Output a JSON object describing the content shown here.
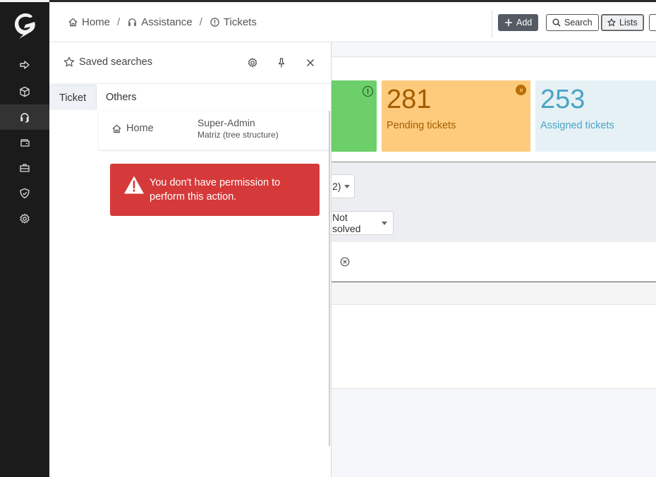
{
  "sidebar": {
    "logo": "glpi-logo",
    "items": [
      {
        "icon": "arrow-right-icon",
        "name": "sidebar-item-plugins"
      },
      {
        "icon": "box-icon",
        "name": "sidebar-item-assets"
      },
      {
        "icon": "headset-icon",
        "name": "sidebar-item-assistance",
        "active": true
      },
      {
        "icon": "wallet-icon",
        "name": "sidebar-item-management"
      },
      {
        "icon": "briefcase-icon",
        "name": "sidebar-item-tools"
      },
      {
        "icon": "shield-icon",
        "name": "sidebar-item-administration"
      },
      {
        "icon": "gear-icon",
        "name": "sidebar-item-setup"
      }
    ]
  },
  "breadcrumb": {
    "home": "Home",
    "sep1": "/",
    "assistance": "Assistance",
    "sep2": "/",
    "tickets": "Tickets"
  },
  "toolbar": {
    "add_label": "Add",
    "search_label": "Search",
    "lists_label": "Lists"
  },
  "stats": {
    "pending_count": "281",
    "pending_label": "Pending tickets",
    "assigned_count": "253",
    "assigned_label": "Assigned tickets"
  },
  "filters": {
    "select1_value": "2)",
    "select2_value": "Not solved"
  },
  "saved_searches": {
    "title": "Saved searches",
    "tabs": [
      "Ticket",
      "Others"
    ],
    "items": [
      {
        "name": "Home",
        "user": "Super-Admin",
        "entity": "Matriz (tree structure)"
      }
    ],
    "alert": "You don't have permission to perform this action."
  },
  "colors": {
    "sidebar_bg": "#1b1b1b",
    "green_card": "#6ccf6a",
    "pending_card": "#fecb7c",
    "assigned_card": "#e6f1f5",
    "alert_bg": "#d63939"
  }
}
